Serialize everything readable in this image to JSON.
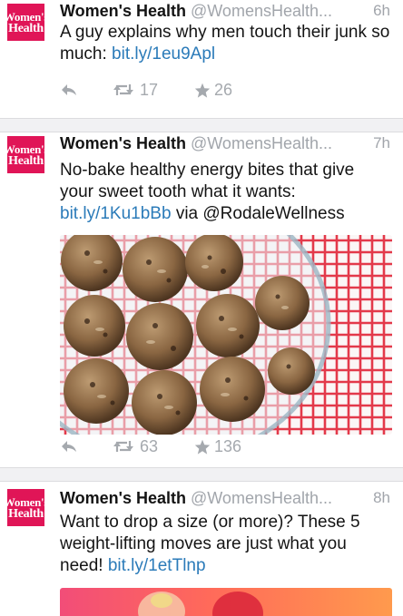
{
  "tweets": [
    {
      "avatar": {
        "line1": "Women's",
        "line2": "Health"
      },
      "name": "Women's Health",
      "handle": "@WomensHealth...",
      "time": "6h",
      "text": "A guy explains why men touch their junk so much:",
      "link": "bit.ly/1eu9Apl",
      "retweets": "17",
      "favorites": "26"
    },
    {
      "avatar": {
        "line1": "Women's",
        "line2": "Health"
      },
      "name": "Women's Health",
      "handle": "@WomensHealth...",
      "time": "7h",
      "text": "No-bake healthy energy bites that give your sweet tooth what it wants:",
      "link": "bit.ly/1Ku1bBb",
      "via": "via @RodaleWellness",
      "retweets": "63",
      "favorites": "136"
    },
    {
      "avatar": {
        "line1": "Women's",
        "line2": "Health"
      },
      "name": "Women's Health",
      "handle": "@WomensHealth...",
      "time": "8h",
      "text": "Want to drop a size (or more)? These 5 weight-lifting moves are just what you need!",
      "link": "bit.ly/1etTlnp"
    }
  ],
  "icons": {
    "reply": "reply-icon",
    "retweet": "retweet-icon",
    "favorite": "star-icon"
  },
  "colors": {
    "brand": "#e01557",
    "link": "#2b7bb9",
    "muted": "#a1a5ab"
  }
}
